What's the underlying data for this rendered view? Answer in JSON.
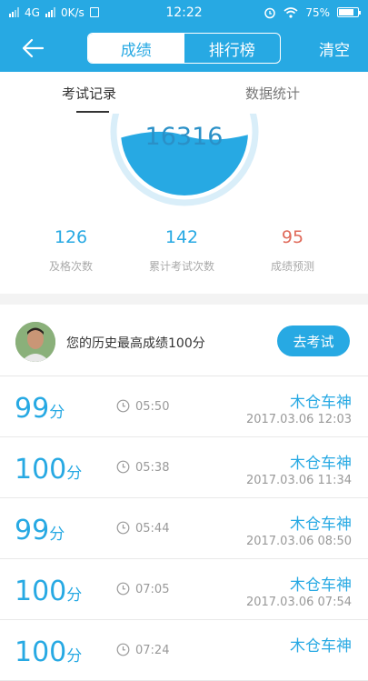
{
  "status_bar": {
    "network": "4G",
    "speed": "0K/s",
    "time": "12:22",
    "battery": "75%"
  },
  "header": {
    "segments": [
      "成绩",
      "排行榜"
    ],
    "clear_label": "清空"
  },
  "tabs": [
    "考试记录",
    "数据统计"
  ],
  "gauge": {
    "score_count": "16316",
    "fill_level": 0.4
  },
  "stats": [
    {
      "value": "126",
      "label": "及格次数",
      "color": "#27a9e3"
    },
    {
      "value": "142",
      "label": "累计考试次数",
      "color": "#27a9e3"
    },
    {
      "value": "95",
      "label": "成绩预测",
      "color": "#e06a5a"
    }
  ],
  "best": {
    "text": "您的历史最高成绩100分",
    "button_label": "去考试"
  },
  "records": [
    {
      "score": "99",
      "unit": "分",
      "duration": "05:50",
      "name": "木仓车神",
      "date": "2017.03.06  12:03"
    },
    {
      "score": "100",
      "unit": "分",
      "duration": "05:38",
      "name": "木仓车神",
      "date": "2017.03.06  11:34"
    },
    {
      "score": "99",
      "unit": "分",
      "duration": "05:44",
      "name": "木仓车神",
      "date": "2017.03.06  08:50"
    },
    {
      "score": "100",
      "unit": "分",
      "duration": "07:05",
      "name": "木仓车神",
      "date": "2017.03.06  07:54"
    },
    {
      "score": "100",
      "unit": "分",
      "duration": "07:24",
      "name": "木仓车神",
      "date": ""
    }
  ],
  "colors": {
    "accent": "#27a9e3",
    "predict": "#e06a5a"
  }
}
